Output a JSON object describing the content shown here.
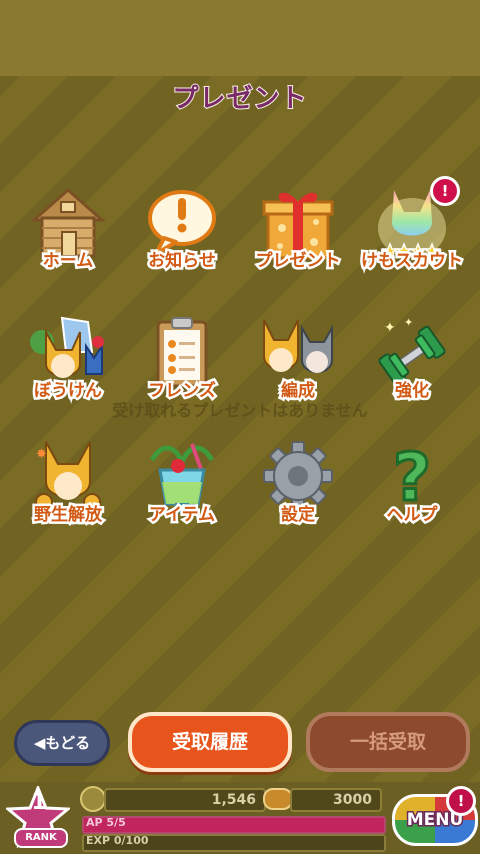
{
  "header": {
    "title": "プレゼント"
  },
  "empty_message": "受け取れるプレゼントはありません",
  "menu_tiles": [
    {
      "label": "ホーム",
      "icon": "house-icon"
    },
    {
      "label": "お知らせ",
      "icon": "notice-speech-bubble-icon"
    },
    {
      "label": "プレゼント",
      "icon": "gift-box-icon"
    },
    {
      "label": "けもスカウト",
      "icon": "rainbow-silhouette-icon",
      "badge": "!"
    },
    {
      "label": "ぼうけん",
      "icon": "adventure-friends-icon"
    },
    {
      "label": "フレンズ",
      "icon": "clipboard-icon"
    },
    {
      "label": "編成",
      "icon": "party-formation-icon"
    },
    {
      "label": "強化",
      "icon": "dumbbell-icon"
    },
    {
      "label": "野生解放",
      "icon": "wild-release-icon"
    },
    {
      "label": "アイテム",
      "icon": "tropical-drink-icon"
    },
    {
      "label": "設定",
      "icon": "gear-icon"
    },
    {
      "label": "ヘルプ",
      "icon": "question-mark-icon"
    }
  ],
  "bottom_buttons": {
    "back": "もどる",
    "history": "受取履歴",
    "bulk_receive": "一括受取"
  },
  "status": {
    "rank_value": "1",
    "rank_label": "RANK",
    "coins": "1,546",
    "japari_bun": "3000",
    "ap_text": "AP 5/5",
    "ap_fraction": 1.0,
    "exp_text": "EXP 0/100",
    "exp_fraction": 0.0,
    "menu_label": "MENU",
    "menu_badge": "!"
  },
  "colors": {
    "label_orange": "#d25a14",
    "badge_red": "#d0104a",
    "history_button": "#e8551c"
  }
}
